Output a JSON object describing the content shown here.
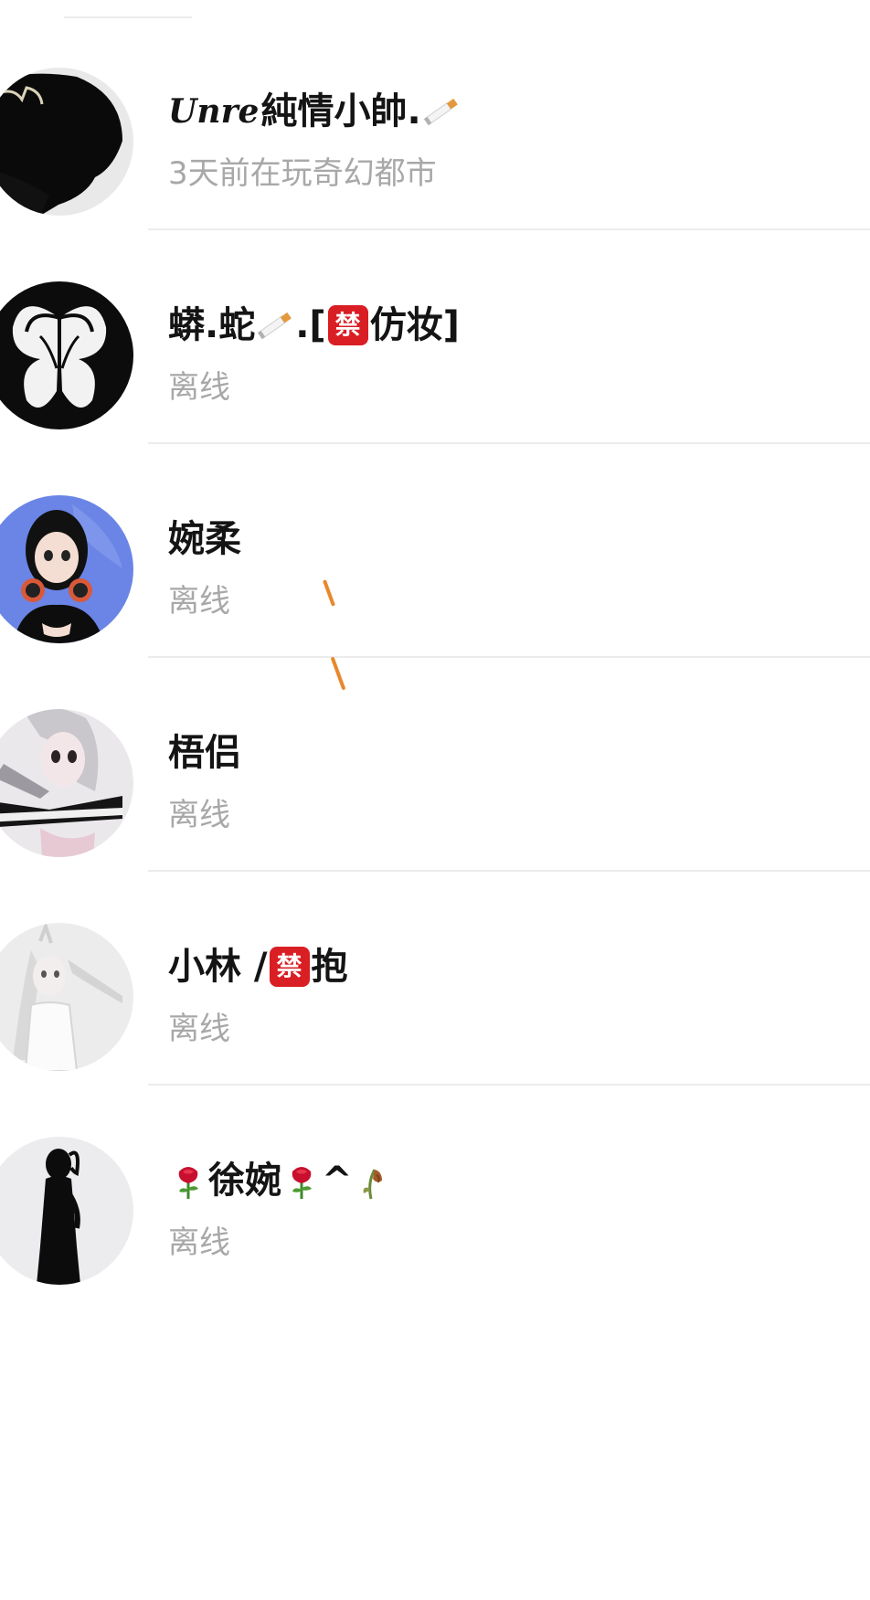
{
  "contacts": [
    {
      "name_prefix": "Unre",
      "name_main": "純情小帥.",
      "name_suffix_icon": "cigarette-emoji",
      "status": "3天前在玩奇幻都市",
      "avatar": "black-silhouette-avatar"
    },
    {
      "name_part1": "蟒.蛇",
      "name_part2": ".[",
      "badge": "禁",
      "name_part3": "仿妆]",
      "status": "离线",
      "avatar": "butterfly-avatar"
    },
    {
      "name": "婉柔",
      "status": "离线",
      "avatar": "anime-girl-headphones-avatar"
    },
    {
      "name": "梧侣",
      "status": "离线",
      "avatar": "white-hair-girl-avatar"
    },
    {
      "name_part1": "小林 / ",
      "badge": "禁",
      "name_part2": "抱",
      "status": "离线",
      "avatar": "white-dress-girl-avatar"
    },
    {
      "name_main": "徐婉",
      "name_caret": "^",
      "status": "离线",
      "avatar": "dark-figure-avatar"
    }
  ],
  "colors": {
    "name_text": "#141414",
    "status_text": "#a8a8a8",
    "divider": "#ececec",
    "badge": "#d91e24",
    "accent_stroke": "#e8882c"
  }
}
